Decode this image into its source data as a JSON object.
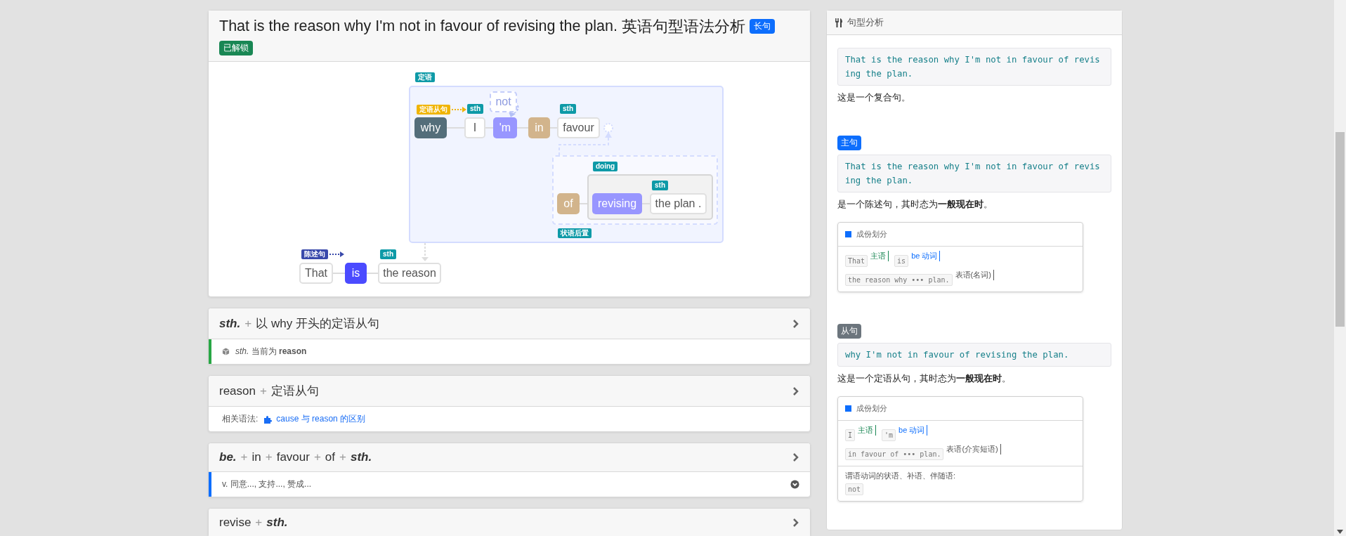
{
  "header": {
    "title": "That is the reason why I'm not in favour of revising the plan.",
    "subtitle": "英语句型语法分析",
    "badges": [
      {
        "text": "长句",
        "color": "#0d6efd"
      },
      {
        "text": "已解锁",
        "color": "#198754"
      }
    ]
  },
  "diagram": {
    "labels": [
      {
        "text": "定语",
        "kind": "role"
      },
      {
        "text": "定语从句",
        "kind": "clause"
      },
      {
        "text": "sth",
        "kind": "role"
      },
      {
        "text": "sth",
        "kind": "role"
      },
      {
        "text": "doing",
        "kind": "role"
      },
      {
        "text": "sth",
        "kind": "role"
      },
      {
        "text": "状语后置",
        "kind": "role"
      },
      {
        "text": "陈述句",
        "kind": "sentence"
      },
      {
        "text": "sth",
        "kind": "role"
      }
    ],
    "words": [
      {
        "text": "why",
        "kind": "relative"
      },
      {
        "text": "I",
        "kind": "noun"
      },
      {
        "text": "'m",
        "kind": "verb"
      },
      {
        "text": "in",
        "kind": "prep"
      },
      {
        "text": "favour",
        "kind": "noun"
      },
      {
        "text": "of",
        "kind": "prep"
      },
      {
        "text": "revising",
        "kind": "verb"
      },
      {
        "text": "the plan .",
        "kind": "noun"
      },
      {
        "text": "That",
        "kind": "noun"
      },
      {
        "text": "is",
        "kind": "main-verb"
      },
      {
        "text": "the reason",
        "kind": "noun"
      },
      {
        "text": "not",
        "kind": "omitted"
      }
    ]
  },
  "cards": [
    {
      "title": [
        {
          "text": "sth.",
          "kind": "var"
        },
        {
          "text": "+",
          "kind": "op"
        },
        {
          "text": "以 why 开头的定语从句",
          "kind": "word"
        }
      ],
      "body": {
        "kind": "note",
        "color": "#28a745",
        "text": "*sth.*  当前为 **reason**"
      }
    },
    {
      "title": [
        {
          "text": "reason",
          "kind": "word"
        },
        {
          "text": "+",
          "kind": "op"
        },
        {
          "text": "定语从句",
          "kind": "word"
        }
      ],
      "body": {
        "kind": "related",
        "label": "相关语法:",
        "link": "cause 与 reason 的区别"
      }
    },
    {
      "title": [
        {
          "text": "be.",
          "kind": "var"
        },
        {
          "text": "+",
          "kind": "op"
        },
        {
          "text": "in",
          "kind": "word"
        },
        {
          "text": "+",
          "kind": "op"
        },
        {
          "text": "favour",
          "kind": "word"
        },
        {
          "text": "+",
          "kind": "op"
        },
        {
          "text": "of",
          "kind": "word"
        },
        {
          "text": "+",
          "kind": "op"
        },
        {
          "text": "sth.",
          "kind": "var"
        }
      ],
      "body": {
        "kind": "meaning",
        "color": "#0d6efd",
        "text": "v. 同意..., 支持..., 赞成..."
      }
    },
    {
      "title": [
        {
          "text": "revise",
          "kind": "word"
        },
        {
          "text": "+",
          "kind": "op"
        },
        {
          "text": "sth.",
          "kind": "var"
        }
      ]
    }
  ],
  "panel": {
    "title": "句型分析",
    "intro": {
      "code": "That is the reason why I'm not in favour of revising the plan.",
      "text": "这是一个复合句。"
    },
    "sections": [
      {
        "badge": {
          "text": "主句",
          "color": "#0d6efd"
        },
        "code": "That is the reason why I'm not in favour of revising the plan.",
        "text": "是一个陈述句，其时态为**一般现在时**。",
        "analysis": {
          "title": "成份划分",
          "tokens": [
            {
              "code": "That",
              "role": "主语",
              "color": "#198754"
            },
            {
              "code": "is",
              "role": "be 动词",
              "color": "#0d6efd"
            },
            {
              "code": "the reason why ••• plan.",
              "role": "表语(名词)",
              "color": "#555555"
            }
          ]
        }
      },
      {
        "badge": {
          "text": "从句",
          "color": "#6c757d"
        },
        "code": "why I'm not in favour of revising the plan.",
        "text": "这是一个定语从句，其时态为**一般现在时**。",
        "analysis": {
          "title": "成份划分",
          "tokens": [
            {
              "code": "I",
              "role": "主语",
              "color": "#198754"
            },
            {
              "code": "'m",
              "role": "be 动词",
              "color": "#0d6efd"
            },
            {
              "code": "in favour of ••• plan.",
              "role": "表语(介宾短语)",
              "color": "#555555"
            }
          ],
          "extra": {
            "label": "谓语动词的状语、补语、伴随语:",
            "tokens": [
              "not"
            ]
          }
        }
      }
    ]
  }
}
